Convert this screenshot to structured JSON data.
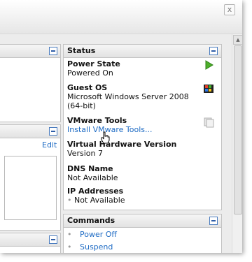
{
  "window": {
    "close_label": "x"
  },
  "status_panel": {
    "title": "Status",
    "power_state": {
      "label": "Power State",
      "value": "Powered On"
    },
    "guest_os": {
      "label": "Guest OS",
      "value_line1": "Microsoft Windows Server 2008",
      "value_line2": "(64-bit)"
    },
    "vmware_tools": {
      "label": "VMware Tools",
      "link": "Install VMware Tools..."
    },
    "hardware_version": {
      "label": "Virtual Hardware Version",
      "value": "Version 7"
    },
    "dns_name": {
      "label": "DNS Name",
      "value": "Not Available"
    },
    "ip_addresses": {
      "label": "IP Addresses",
      "value": "Not Available"
    }
  },
  "left_panel_middle": {
    "edit_link": "Edit"
  },
  "commands_panel": {
    "title": "Commands",
    "items": [
      "Power Off",
      "Suspend"
    ]
  },
  "colors": {
    "link": "#1e6bc4",
    "play_icon": "#4caf2a"
  }
}
